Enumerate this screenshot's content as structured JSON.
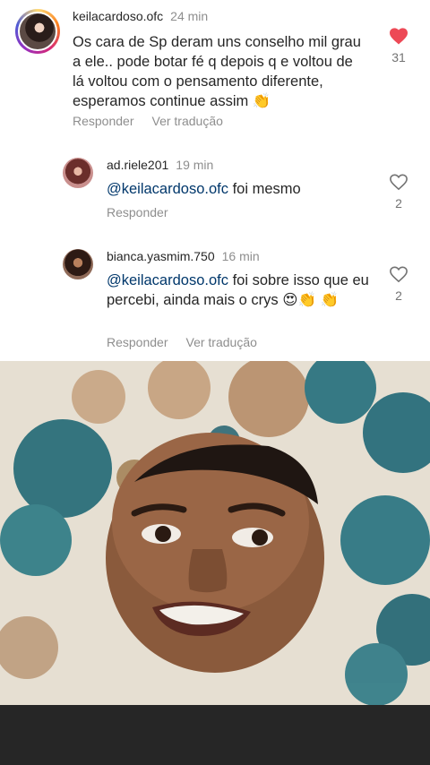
{
  "comments": [
    {
      "username": "keilacardoso.ofc",
      "time": "24 min",
      "text": "Os cara de Sp deram uns conselho mil grau a ele.. pode botar fé q depois q e voltou de lá voltou com o pensamento diferente, esperamos continue assim 👏",
      "reply_label": "Responder",
      "translate_label": "Ver tradução",
      "likes": "31",
      "liked": true
    },
    {
      "username": "ad.riele201",
      "time": "19 min",
      "mention": "@keilacardoso.ofc",
      "text": "foi mesmo",
      "reply_label": "Responder",
      "likes": "2",
      "liked": false
    },
    {
      "username": "bianca.yasmim.750",
      "time": "16 min",
      "mention": "@keilacardoso.ofc",
      "text": "foi sobre isso que eu percebi, ainda mais o crys 😍👏 👏",
      "reply_label": "Responder",
      "translate_label": "Ver tradução",
      "likes": "2",
      "liked": false
    }
  ],
  "colors": {
    "liked_heart": "#ed4956",
    "mention": "#00376b",
    "secondary_text": "#8e8e8e"
  }
}
